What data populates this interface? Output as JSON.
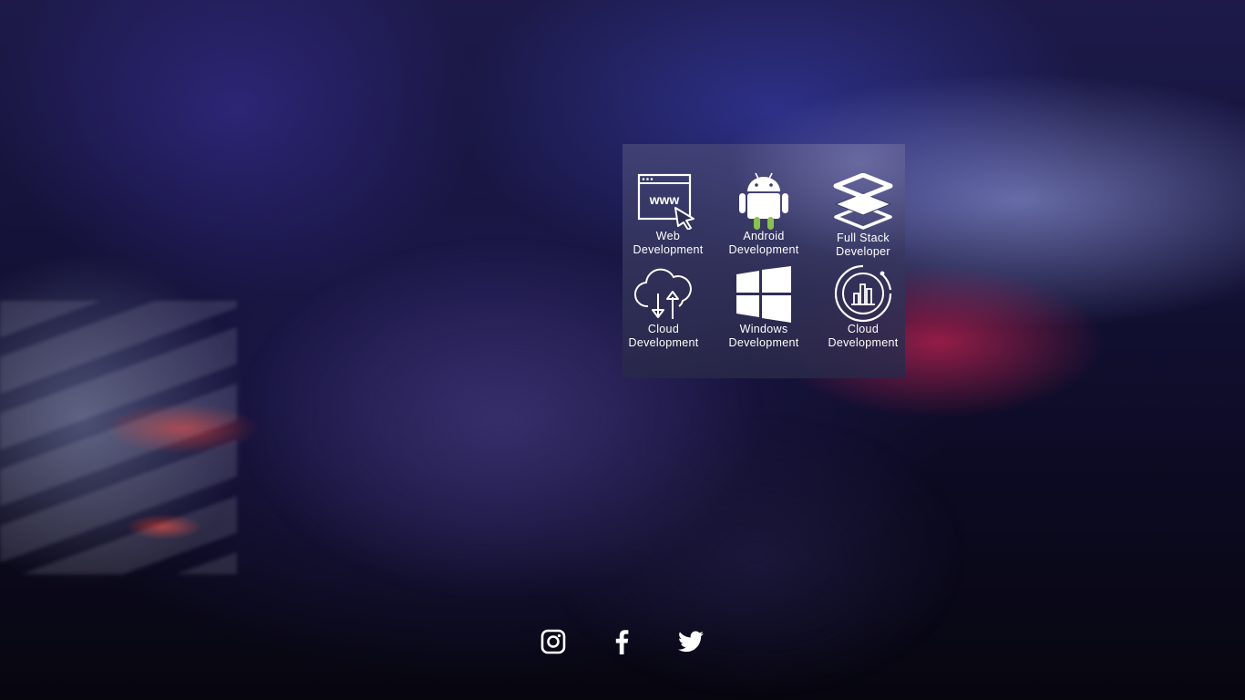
{
  "services": [
    {
      "icon": "web-browser-cursor-icon",
      "label": "Web\nDevelopment"
    },
    {
      "icon": "android-icon",
      "label": "Android\nDevelopment"
    },
    {
      "icon": "layers-stack-icon",
      "label": "Full Stack\nDeveloper"
    },
    {
      "icon": "cloud-transfer-icon",
      "label": "Cloud\nDevelopment"
    },
    {
      "icon": "windows-logo-icon",
      "label": "Windows\nDevelopment"
    },
    {
      "icon": "analytics-chart-circle-icon",
      "label": "Cloud\nDevelopment"
    }
  ],
  "social": [
    {
      "icon": "instagram-icon",
      "name": "Instagram"
    },
    {
      "icon": "facebook-icon",
      "name": "Facebook"
    },
    {
      "icon": "twitter-icon",
      "name": "Twitter"
    }
  ],
  "colors": {
    "android_green": "#8bc34a",
    "icon_white": "#ffffff",
    "card_overlay": "#3c3c6a"
  }
}
